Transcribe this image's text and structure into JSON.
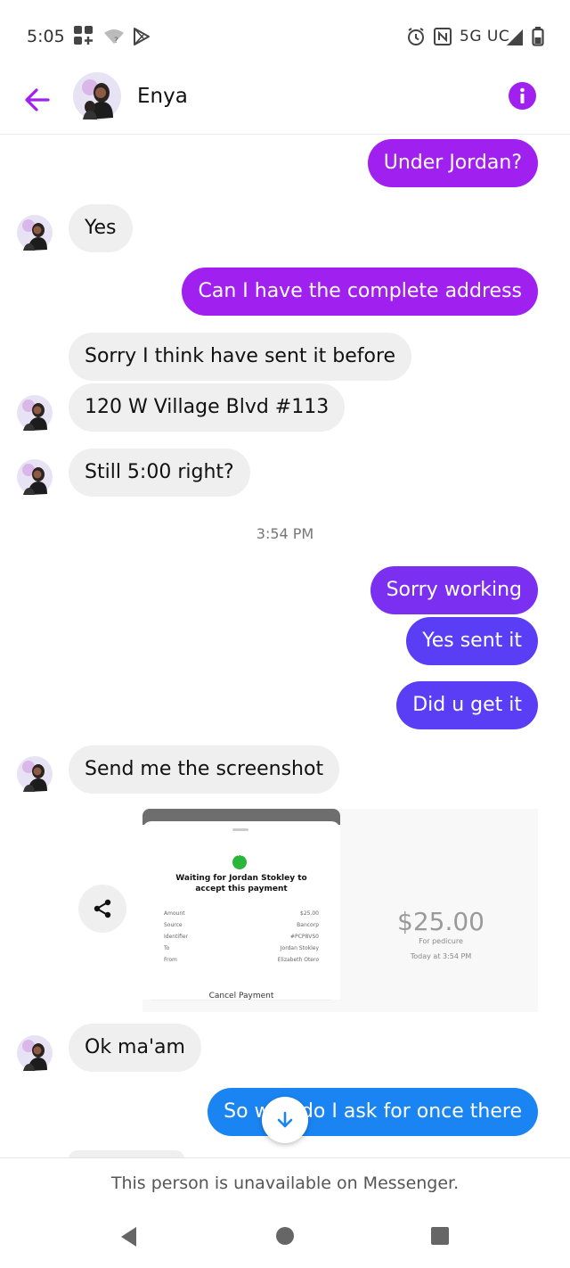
{
  "status_bar": {
    "time": "5:05",
    "network": "5G UC"
  },
  "header": {
    "contact_name": "Enya"
  },
  "messages": [
    {
      "from": "me",
      "text": "Under Jordan?"
    },
    {
      "from": "them",
      "text": "Yes"
    },
    {
      "from": "me",
      "text": "Can I have the complete address"
    },
    {
      "from": "them",
      "text": "Sorry I think have sent it before"
    },
    {
      "from": "them",
      "text": "120 W Village Blvd #113"
    },
    {
      "from": "them",
      "text": "Still 5:00 right?"
    },
    {
      "from": "me",
      "text": "Sorry working"
    },
    {
      "from": "me",
      "text": "Yes sent it"
    },
    {
      "from": "me",
      "text": "Did u get it"
    },
    {
      "from": "them",
      "text": "Send me the screenshot"
    },
    {
      "from": "them",
      "text": "Ok ma'am"
    },
    {
      "from": "me",
      "text": "So who do I ask for once there"
    }
  ],
  "timestamp": "3:54 PM",
  "payment": {
    "title": "Waiting for Jordan Stokley to accept this payment",
    "rows": [
      {
        "label": "Amount",
        "value": "$25.00"
      },
      {
        "label": "Source",
        "value": "Bancorp"
      },
      {
        "label": "Identifier",
        "value": "#PCP8VS0"
      },
      {
        "label": "To",
        "value": "Jordan Stokley"
      },
      {
        "label": "From",
        "value": "Elizabeth Otero"
      }
    ],
    "cancel_label": "Cancel Payment",
    "amount": "$25.00",
    "memo": "For pedicure",
    "date": "Today at 3:54 PM"
  },
  "footer": {
    "unavailable_text": "This person is unavailable on Messenger."
  },
  "colors": {
    "accent": "#a020f0",
    "incoming_bubble": "#efefef",
    "latest_outgoing": "#1b84f3"
  }
}
